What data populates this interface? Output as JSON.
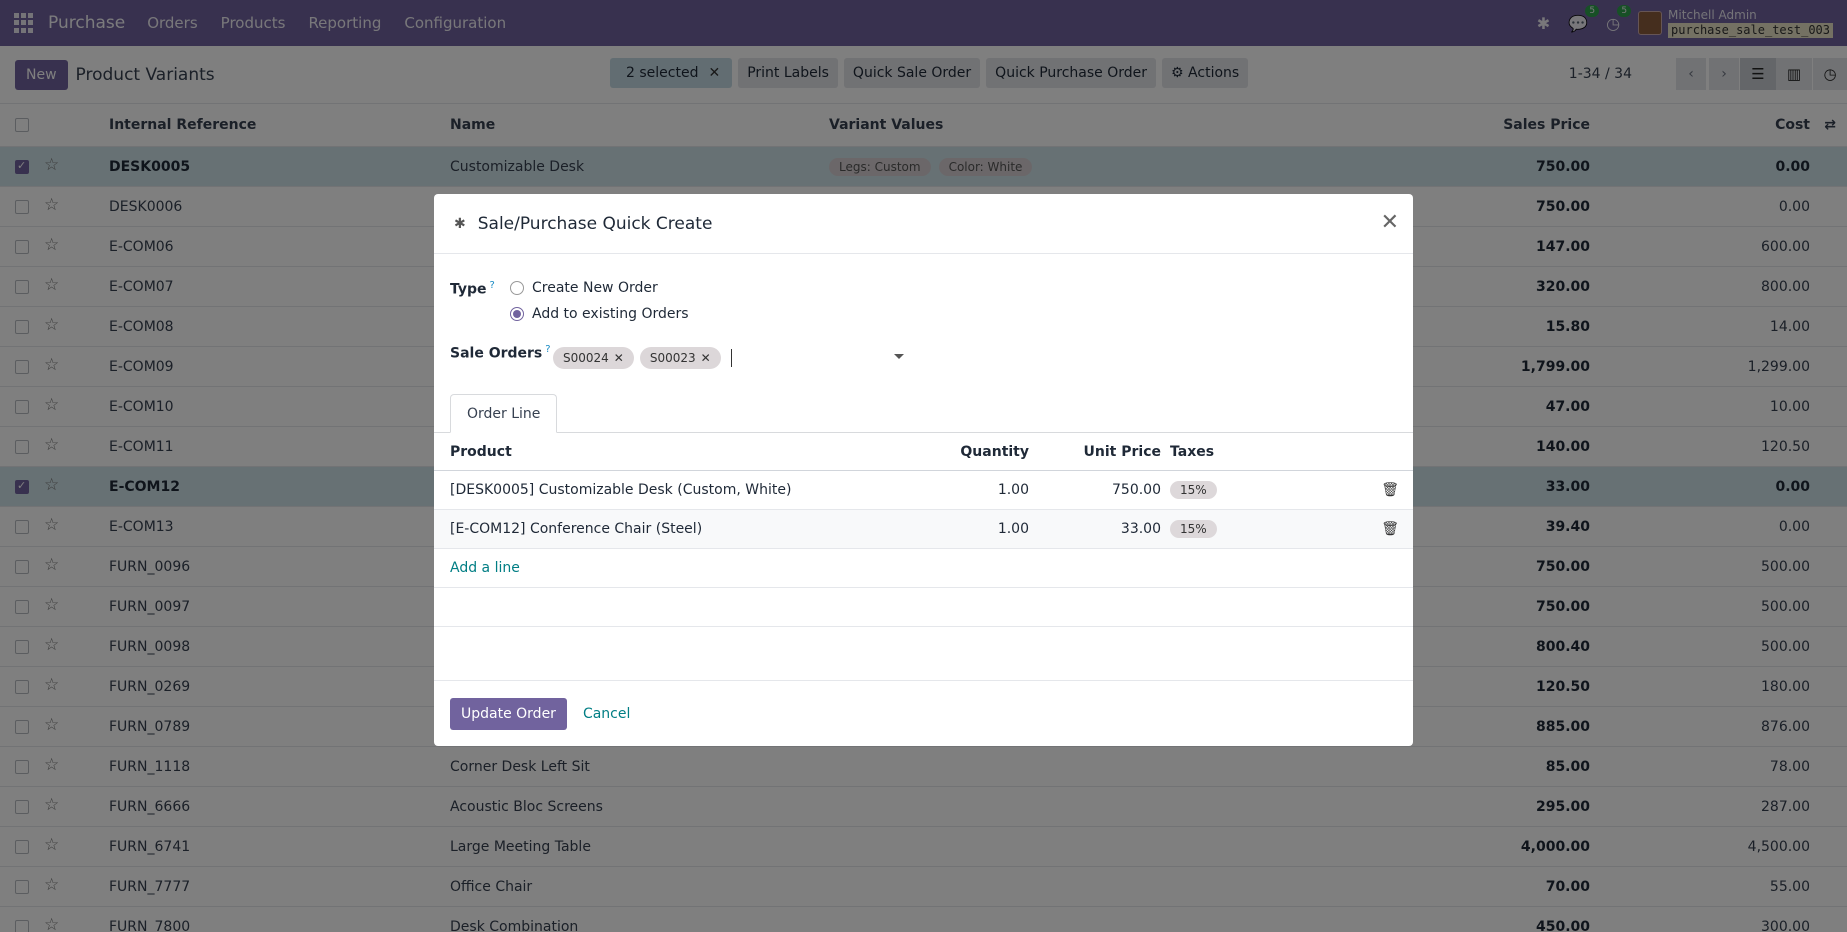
{
  "navbar": {
    "brand": "Purchase",
    "menu": [
      "Orders",
      "Products",
      "Reporting",
      "Configuration"
    ],
    "messages_count": "5",
    "activities_count": "5",
    "user_name": "Mitchell Admin",
    "database": "purchase_sale_test_003"
  },
  "control_panel": {
    "new_label": "New",
    "title": "Product Variants",
    "selected_label": "2 selected",
    "print_labels": "Print Labels",
    "quick_sale_order": "Quick Sale Order",
    "quick_purchase_order": "Quick Purchase Order",
    "actions": "Actions",
    "pager": "1-34 / 34"
  },
  "list": {
    "columns": {
      "ref": "Internal Reference",
      "name": "Name",
      "variant": "Variant Values",
      "price": "Sales Price",
      "cost": "Cost"
    },
    "rows": [
      {
        "ref": "DESK0005",
        "name": "Customizable Desk",
        "v1": "Legs: Custom",
        "v2": "Color: White",
        "price": "750.00",
        "cost": "0.00"
      },
      {
        "ref": "DESK0006",
        "name": "",
        "v1": "",
        "v2": "",
        "price": "750.00",
        "cost": "0.00"
      },
      {
        "ref": "E-COM06",
        "name": "",
        "v1": "",
        "v2": "",
        "price": "147.00",
        "cost": "600.00"
      },
      {
        "ref": "E-COM07",
        "name": "",
        "v1": "",
        "v2": "",
        "price": "320.00",
        "cost": "800.00"
      },
      {
        "ref": "E-COM08",
        "name": "",
        "v1": "",
        "v2": "",
        "price": "15.80",
        "cost": "14.00"
      },
      {
        "ref": "E-COM09",
        "name": "",
        "v1": "",
        "v2": "",
        "price": "1,799.00",
        "cost": "1,299.00"
      },
      {
        "ref": "E-COM10",
        "name": "",
        "v1": "",
        "v2": "",
        "price": "47.00",
        "cost": "10.00"
      },
      {
        "ref": "E-COM11",
        "name": "",
        "v1": "",
        "v2": "",
        "price": "140.00",
        "cost": "120.50"
      },
      {
        "ref": "E-COM12",
        "name": "",
        "v1": "",
        "v2": "",
        "price": "33.00",
        "cost": "0.00"
      },
      {
        "ref": "E-COM13",
        "name": "",
        "v1": "",
        "v2": "",
        "price": "39.40",
        "cost": "0.00"
      },
      {
        "ref": "FURN_0096",
        "name": "",
        "v1": "",
        "v2": "",
        "price": "750.00",
        "cost": "500.00"
      },
      {
        "ref": "FURN_0097",
        "name": "",
        "v1": "",
        "v2": "",
        "price": "750.00",
        "cost": "500.00"
      },
      {
        "ref": "FURN_0098",
        "name": "",
        "v1": "",
        "v2": "",
        "price": "800.40",
        "cost": "500.00"
      },
      {
        "ref": "FURN_0269",
        "name": "",
        "v1": "",
        "v2": "",
        "price": "120.50",
        "cost": "180.00"
      },
      {
        "ref": "FURN_0789",
        "name": "",
        "v1": "",
        "v2": "",
        "price": "885.00",
        "cost": "876.00"
      },
      {
        "ref": "FURN_1118",
        "name": "Corner Desk Left Sit",
        "v1": "",
        "v2": "",
        "price": "85.00",
        "cost": "78.00"
      },
      {
        "ref": "FURN_6666",
        "name": "Acoustic Bloc Screens",
        "v1": "",
        "v2": "",
        "price": "295.00",
        "cost": "287.00"
      },
      {
        "ref": "FURN_6741",
        "name": "Large Meeting Table",
        "v1": "",
        "v2": "",
        "price": "4,000.00",
        "cost": "4,500.00"
      },
      {
        "ref": "FURN_7777",
        "name": "Office Chair",
        "v1": "",
        "v2": "",
        "price": "70.00",
        "cost": "55.00"
      },
      {
        "ref": "FURN_7800",
        "name": "Desk Combination",
        "v1": "",
        "v2": "",
        "price": "450.00",
        "cost": "300.00"
      }
    ]
  },
  "modal": {
    "title": "Sale/Purchase Quick Create",
    "type_label": "Type",
    "type_option_new": "Create New Order",
    "type_option_existing": "Add to existing Orders",
    "sale_orders_label": "Sale Orders",
    "tag_1": "S00024",
    "tag_2": "S00023",
    "tab_label": "Order Line",
    "lines_header": {
      "product": "Product",
      "quantity": "Quantity",
      "unit_price": "Unit Price",
      "taxes": "Taxes"
    },
    "lines": [
      {
        "product": "[DESK0005] Customizable Desk (Custom, White)",
        "quantity": "1.00",
        "unit_price": "750.00",
        "tax": "15%"
      },
      {
        "product": "[E-COM12] Conference Chair (Steel)",
        "quantity": "1.00",
        "unit_price": "33.00",
        "tax": "15%"
      }
    ],
    "add_line": "Add a line",
    "update_order": "Update Order",
    "cancel": "Cancel"
  }
}
